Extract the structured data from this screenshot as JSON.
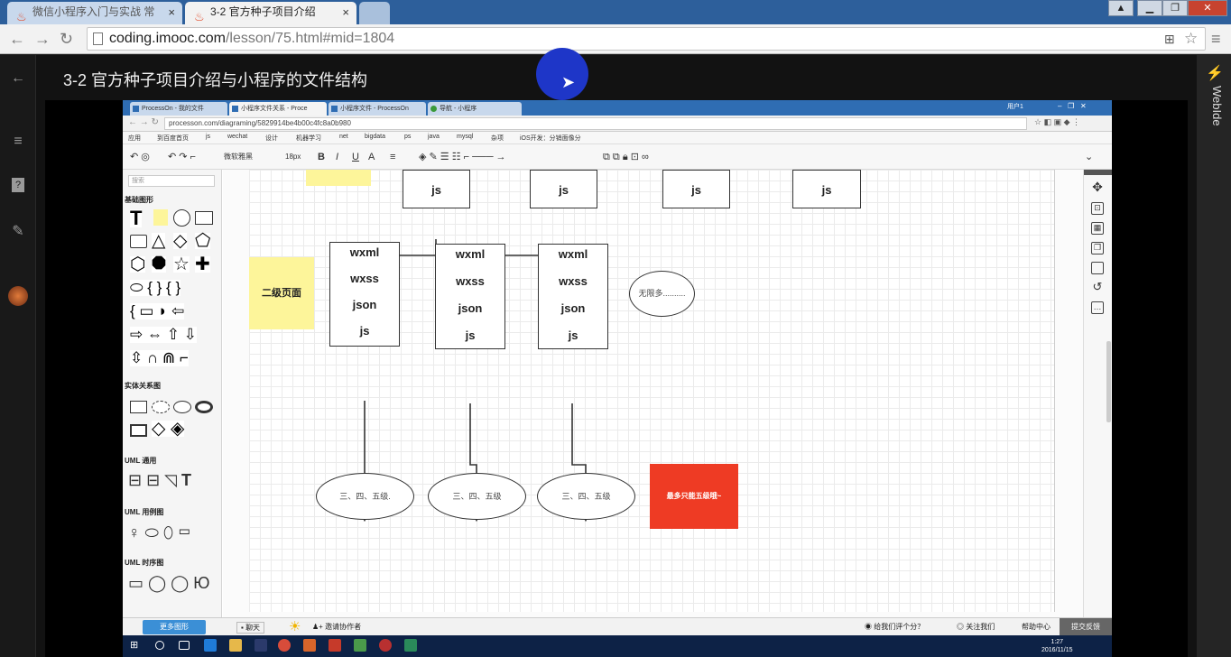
{
  "browser": {
    "tabs": [
      {
        "label": "微信小程序入门与实战 常",
        "active": false
      },
      {
        "label": "3-2 官方种子项目介绍",
        "active": true
      }
    ],
    "url_host": "coding.imooc.com",
    "url_path": "/lesson/75.html#mid=1804"
  },
  "page": {
    "title": "3-2 官方种子项目介绍与小程序的文件结构",
    "right_panel_label": "WebIde"
  },
  "inner": {
    "tabs": [
      "ProcessOn - 我的文件",
      "小程序文件关系 - Proce",
      "小程序文件 - ProcessOn",
      "导航 - 小程序"
    ],
    "user_label": "用户1",
    "url": "processon.com/diagraming/5829914be4b00c4fc8a0b980",
    "bookmarks": [
      "应用",
      "到百度首页",
      "js",
      "wechat",
      "设计",
      "机器学习",
      "net",
      "bigdata",
      "ps",
      "java",
      "mysql",
      "杂项",
      "iOS开发：分销面像分"
    ],
    "toolbar": {
      "font": "微软雅黑",
      "size": "18px"
    },
    "sidebar": {
      "search_placeholder": "搜索",
      "sections": [
        "基础图形",
        "实体关系图",
        "UML 通用",
        "UML 用例图",
        "UML 时序图"
      ],
      "more_button": "更多图形"
    },
    "diagram": {
      "top_boxes": [
        "js",
        "js",
        "js",
        "js"
      ],
      "page_boxes": [
        [
          "wxml",
          "wxss",
          "json",
          "js"
        ],
        [
          "wxml",
          "wxss",
          "json",
          "js"
        ],
        [
          "wxml",
          "wxss",
          "json",
          "js"
        ]
      ],
      "note_level2": "二级页面",
      "unlimited": "无限多..........",
      "ovals": [
        "三、四、五级.",
        "三、四、五级",
        "三、四、五级"
      ],
      "max_note": "最多只能五级哦~"
    },
    "bottom": {
      "chat": "聊天",
      "invite": "邀请协作者",
      "rate": "给我们评个分？",
      "follow": "关注我们",
      "help": "帮助中心",
      "feedback": "提交反馈"
    },
    "clock": {
      "time": "1:27",
      "date": "2016/11/15"
    }
  }
}
